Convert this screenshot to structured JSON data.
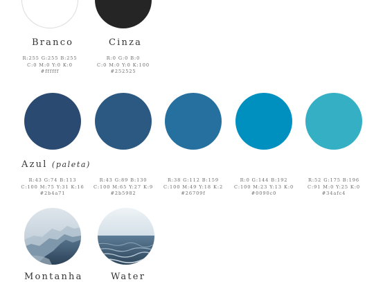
{
  "neutrals": [
    {
      "name": "Branco",
      "color": "#ffffff",
      "rgb": "R:255 G:255 B:255",
      "cmyk": "C:0 M:0 Y:0 K:0",
      "hex": "#ffffff"
    },
    {
      "name": "Cinza",
      "color": "#252525",
      "rgb": "R:0 G:0 B:0",
      "cmyk": "C:0 M:0 Y:0 K:100",
      "hex": "#252525"
    }
  ],
  "palette": {
    "title": "Azul",
    "subtitle": "(paleta)",
    "colors": [
      {
        "color": "#2b4a71",
        "rgb": "R:43 G:74 B:113",
        "cmyk": "C:100 M:75 Y:31 K:16",
        "hex": "#2b4a71"
      },
      {
        "color": "#2b5982",
        "rgb": "R:43 G:89 B:130",
        "cmyk": "C:100 M:65 Y:27 K:9",
        "hex": "#2b5982"
      },
      {
        "color": "#26709f",
        "rgb": "R:38 G:112 B:159",
        "cmyk": "C:100 M:49 Y:18 K:2",
        "hex": "#26709f"
      },
      {
        "color": "#0090c0",
        "rgb": "R:0 G:144 B:192",
        "cmyk": "C:100 M:23 Y:13 K:0",
        "hex": "#0090c0"
      },
      {
        "color": "#34afc4",
        "rgb": "R:52 G:175 B:196",
        "cmyk": "C:91 M:0 Y:25 K:0",
        "hex": "#34afc4"
      }
    ]
  },
  "photos": [
    {
      "name": "Montanha",
      "image": "mountain-photo"
    },
    {
      "name": "Water",
      "image": "ocean-photo"
    }
  ]
}
